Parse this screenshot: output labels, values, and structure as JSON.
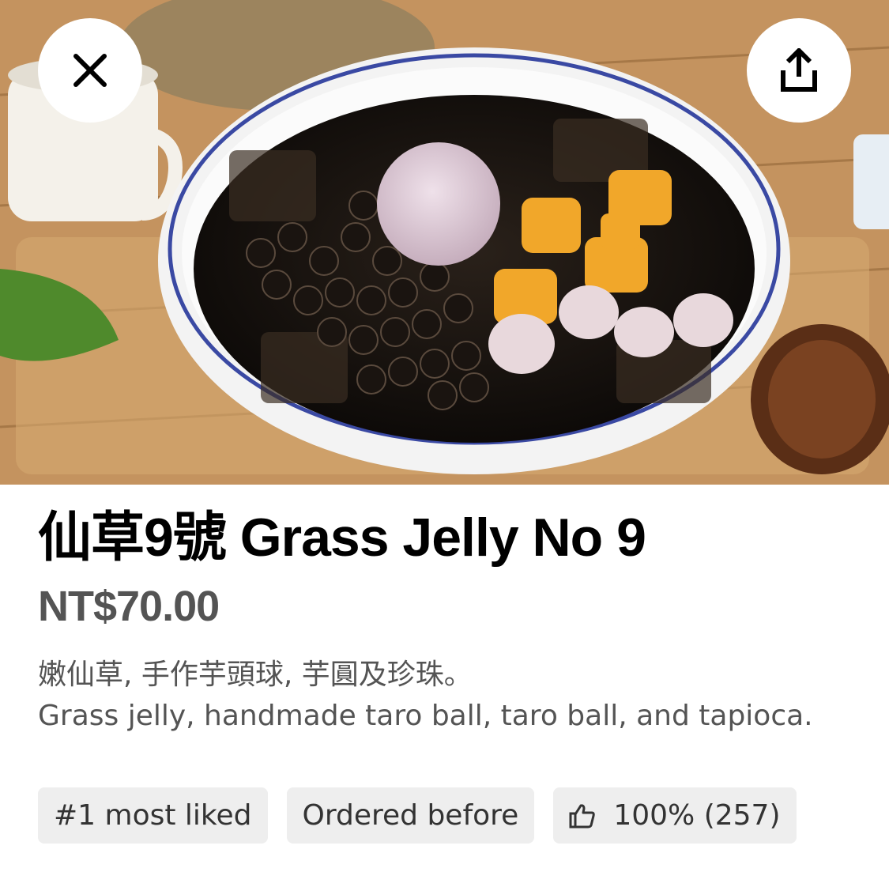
{
  "hero": {
    "image_alt": "Bowl of grass jelly with taro balls, taro ice cream and tapioca pearls",
    "close_icon": "close-icon",
    "share_icon": "share-icon"
  },
  "item": {
    "title": "仙草9號 Grass Jelly No 9",
    "price": "NT$70.00",
    "description_zh": "嫩仙草, 手作芋頭球, 芋圓及珍珠。",
    "description_en": "Grass jelly, handmade taro ball, taro ball, and tapioca."
  },
  "badges": {
    "most_liked": "#1 most liked",
    "ordered_before": "Ordered before",
    "rating": "100% (257)",
    "rating_icon": "thumbs-up-icon"
  }
}
